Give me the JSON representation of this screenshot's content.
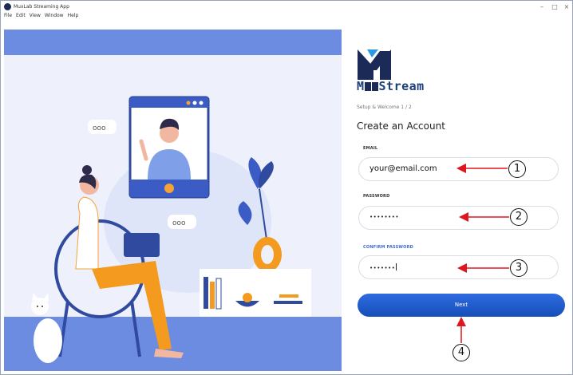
{
  "window": {
    "title": "MuxLab Streaming App",
    "menu": [
      "File",
      "Edit",
      "View",
      "Window",
      "Help"
    ],
    "controls": {
      "minimize": "–",
      "maximize": "□",
      "close": "×"
    }
  },
  "brand": {
    "name": "Stream",
    "logo_icon": "mux-logo-icon"
  },
  "setup": {
    "step": "Setup & Welcome 1 / 2",
    "heading": "Create an Account"
  },
  "form": {
    "email": {
      "label": "EMAIL",
      "value": "your@email.com"
    },
    "password": {
      "label": "PASSWORD",
      "value": "••••••••"
    },
    "confirm_password": {
      "label": "CONFIRM PASSWORD",
      "value": "•••••••"
    },
    "next_label": "Next"
  },
  "annotations": [
    "1",
    "2",
    "3",
    "4"
  ],
  "colors": {
    "accent": "#1f5cd0",
    "illustration_bg": "#eef1fb",
    "band": "#6b8ce0",
    "annotation_arrow": "#e0161e"
  }
}
